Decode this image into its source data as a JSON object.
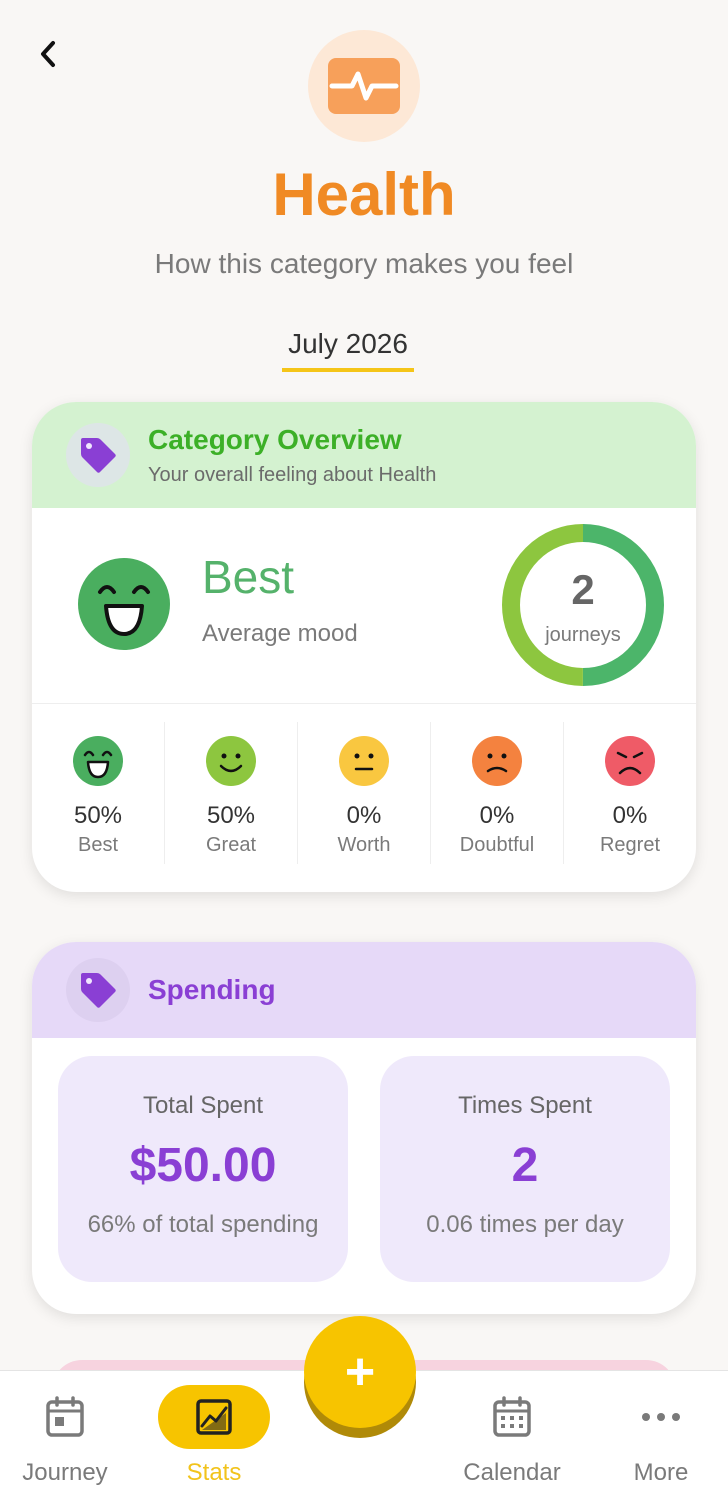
{
  "header": {
    "title": "Health",
    "subtitle": "How this category makes you feel",
    "month": "July 2026",
    "category_color": "#f08a24"
  },
  "overview": {
    "title": "Category Overview",
    "subtitle": "Your overall feeling about Health",
    "mood_label": "Best",
    "mood_caption": "Average mood",
    "journeys_count": "2",
    "journeys_label": "journeys",
    "donut_split": [
      0.5,
      0.5
    ],
    "donut_colors": [
      "#4cb56a",
      "#8dc63f"
    ],
    "moods": [
      {
        "pct": "50%",
        "name": "Best",
        "color": "#4cb56a"
      },
      {
        "pct": "50%",
        "name": "Great",
        "color": "#8dc63f"
      },
      {
        "pct": "0%",
        "name": "Worth",
        "color": "#f9c740"
      },
      {
        "pct": "0%",
        "name": "Doubtful",
        "color": "#f4823f"
      },
      {
        "pct": "0%",
        "name": "Regret",
        "color": "#ef5b67"
      }
    ]
  },
  "spending": {
    "title": "Spending",
    "total_label": "Total Spent",
    "total_value": "$50.00",
    "total_note": "66% of total spending",
    "times_label": "Times Spent",
    "times_value": "2",
    "times_note": "0.06 times per day"
  },
  "nav": {
    "journey": "Journey",
    "stats": "Stats",
    "add": "+",
    "calendar": "Calendar",
    "more": "More"
  }
}
